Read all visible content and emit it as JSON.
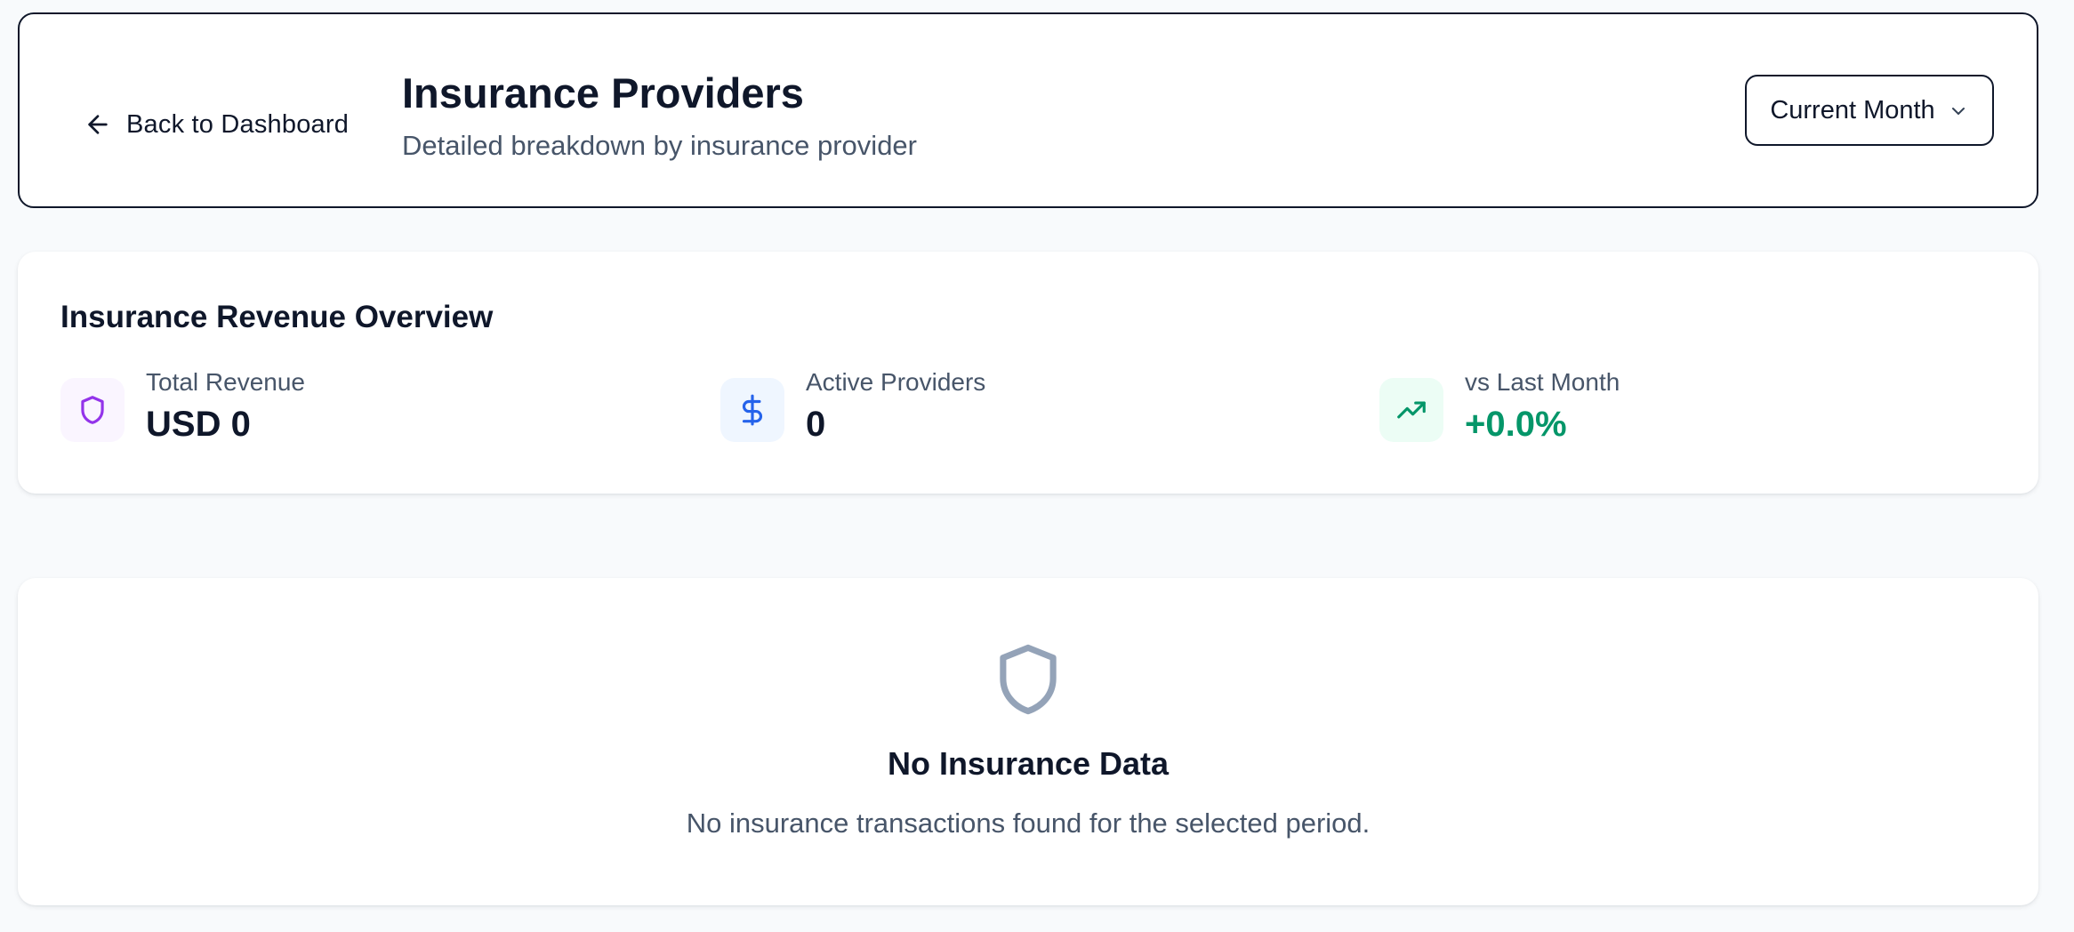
{
  "header": {
    "back_label": "Back to Dashboard",
    "title": "Insurance Providers",
    "subtitle": "Detailed breakdown by insurance provider",
    "period_select": {
      "selected": "Current Month"
    }
  },
  "overview": {
    "title": "Insurance Revenue Overview",
    "stats": [
      {
        "label": "Total Revenue",
        "value": "USD 0",
        "icon": "shield-icon",
        "icon_color": "#9333ea",
        "icon_bg": "#faf5ff",
        "value_color": "#0f172a"
      },
      {
        "label": "Active Providers",
        "value": "0",
        "icon": "dollar-icon",
        "icon_color": "#2563eb",
        "icon_bg": "#eff6ff",
        "value_color": "#0f172a"
      },
      {
        "label": "vs Last Month",
        "value": "+0.0%",
        "icon": "trending-up-icon",
        "icon_color": "#059669",
        "icon_bg": "#ecfdf5",
        "value_color": "#059669"
      }
    ]
  },
  "empty_state": {
    "icon": "shield-icon",
    "title": "No Insurance Data",
    "description": "No insurance transactions found for the selected period."
  }
}
